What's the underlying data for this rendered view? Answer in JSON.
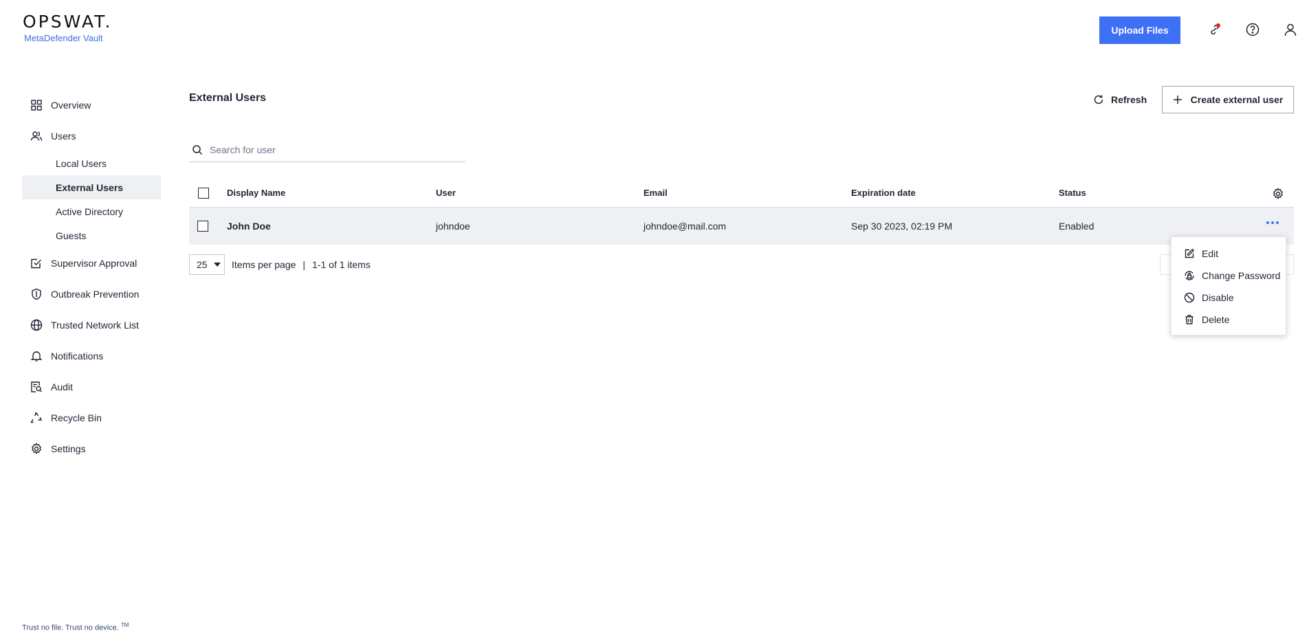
{
  "header": {
    "brand": "OPSWAT.",
    "product": "MetaDefender Vault",
    "upload_label": "Upload Files"
  },
  "sidebar": {
    "items": [
      {
        "label": "Overview",
        "icon": "grid-icon"
      },
      {
        "label": "Users",
        "icon": "users-icon"
      },
      {
        "label": "Supervisor Approval",
        "icon": "approval-check-icon"
      },
      {
        "label": "Outbreak Prevention",
        "icon": "shield-icon"
      },
      {
        "label": "Trusted Network List",
        "icon": "globe-icon"
      },
      {
        "label": "Notifications",
        "icon": "bell-icon"
      },
      {
        "label": "Audit",
        "icon": "audit-icon"
      },
      {
        "label": "Recycle Bin",
        "icon": "recycle-icon"
      },
      {
        "label": "Settings",
        "icon": "gear-icon"
      }
    ],
    "users_sub": [
      "Local Users",
      "External Users",
      "Active Directory",
      "Guests"
    ],
    "tagline": "Trust no file. Trust no device.",
    "tagline_tm": "TM"
  },
  "main": {
    "title": "External Users",
    "refresh_label": "Refresh",
    "create_label": "Create external user",
    "search_placeholder": "Search for user",
    "columns": [
      "Display Name",
      "User",
      "Email",
      "Expiration date",
      "Status"
    ],
    "rows": [
      {
        "display_name": "John Doe",
        "user": "johndoe",
        "email": "johndoe@mail.com",
        "expiration": "Sep 30 2023, 02:19 PM",
        "status": "Enabled"
      }
    ],
    "pager": {
      "per_page": "25",
      "per_page_label": "Items per page",
      "separator": "|",
      "range": "1-1 of 1 items"
    }
  },
  "menu": {
    "items": [
      {
        "label": "Edit",
        "icon": "edit-icon"
      },
      {
        "label": "Change Password",
        "icon": "change-password-icon"
      },
      {
        "label": "Disable",
        "icon": "disable-icon"
      },
      {
        "label": "Delete",
        "icon": "trash-icon"
      }
    ]
  },
  "colors": {
    "accent": "#3d70f5",
    "selected_bg": "#eef0f3",
    "notification_dot": "#e02424"
  }
}
